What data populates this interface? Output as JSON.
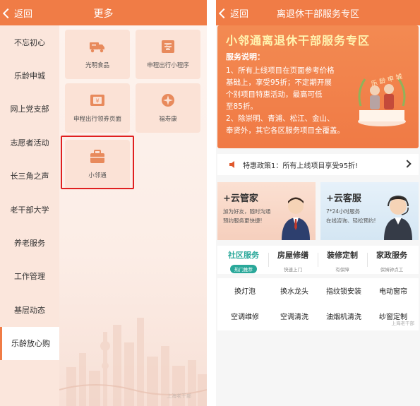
{
  "left": {
    "back_label": "返回",
    "title": "更多",
    "sidebar": [
      {
        "label": "不忘初心"
      },
      {
        "label": "乐龄申城"
      },
      {
        "label": "网上党支部"
      },
      {
        "label": "志愿者活动"
      },
      {
        "label": "长三角之声"
      },
      {
        "label": "老干部大学"
      },
      {
        "label": "养老服务"
      },
      {
        "label": "工作管理"
      },
      {
        "label": "基层动态"
      },
      {
        "label": "乐龄放心购"
      }
    ],
    "tiles": [
      {
        "label": "光明食品",
        "icon": "truck-icon"
      },
      {
        "label": "申程出行小程序",
        "icon": "ticket-icon"
      },
      {
        "label": "申程出行领券页面",
        "icon": "coupon-icon"
      },
      {
        "label": "福寿康",
        "icon": "flower-icon"
      },
      {
        "label": "小邻通",
        "icon": "briefcase-icon"
      }
    ],
    "watermark": "上海老干部"
  },
  "right": {
    "back_label": "返回",
    "title": "离退休干部服务专区",
    "banner": {
      "title": "小邻通离退休干部服务专区",
      "heading": "服务说明：",
      "lines": [
        "1、所有上线项目在页面参考价格",
        "基础上，享受95折；不定期开展",
        "个别项目特惠活动，最高可低",
        "至85折。",
        "2、除崇明、青浦、松江、金山、",
        "奉贤外，其它各区服务项目全覆盖。"
      ],
      "seal_text": "乐龄申城"
    },
    "notice": "特惠政策1：所有上线项目享受95折!",
    "cards": [
      {
        "title": "+云管家",
        "sub1": "加为好友，随时沟通",
        "sub2": "预约服务更快捷!"
      },
      {
        "title": "+云客服",
        "sub1": "7*24小时服务",
        "sub2": "在线咨询、轻松预约!"
      }
    ],
    "tabs": [
      {
        "name": "社区服务",
        "sub": "热门推荐"
      },
      {
        "name": "房屋修缮",
        "sub": "快速上门"
      },
      {
        "name": "装修定制",
        "sub": "有保障"
      },
      {
        "name": "家政服务",
        "sub": "保姆钟点工"
      }
    ],
    "services": [
      "换灯泡",
      "换水龙头",
      "指纹锁安装",
      "电动窗帘",
      "空调维修",
      "空调清洗",
      "油烟机清洗",
      "纱窗定制"
    ],
    "watermark": "上海老干部"
  },
  "colors": {
    "accent": "#f07c46",
    "teal": "#2aa89a",
    "highlight": "#e02020"
  }
}
